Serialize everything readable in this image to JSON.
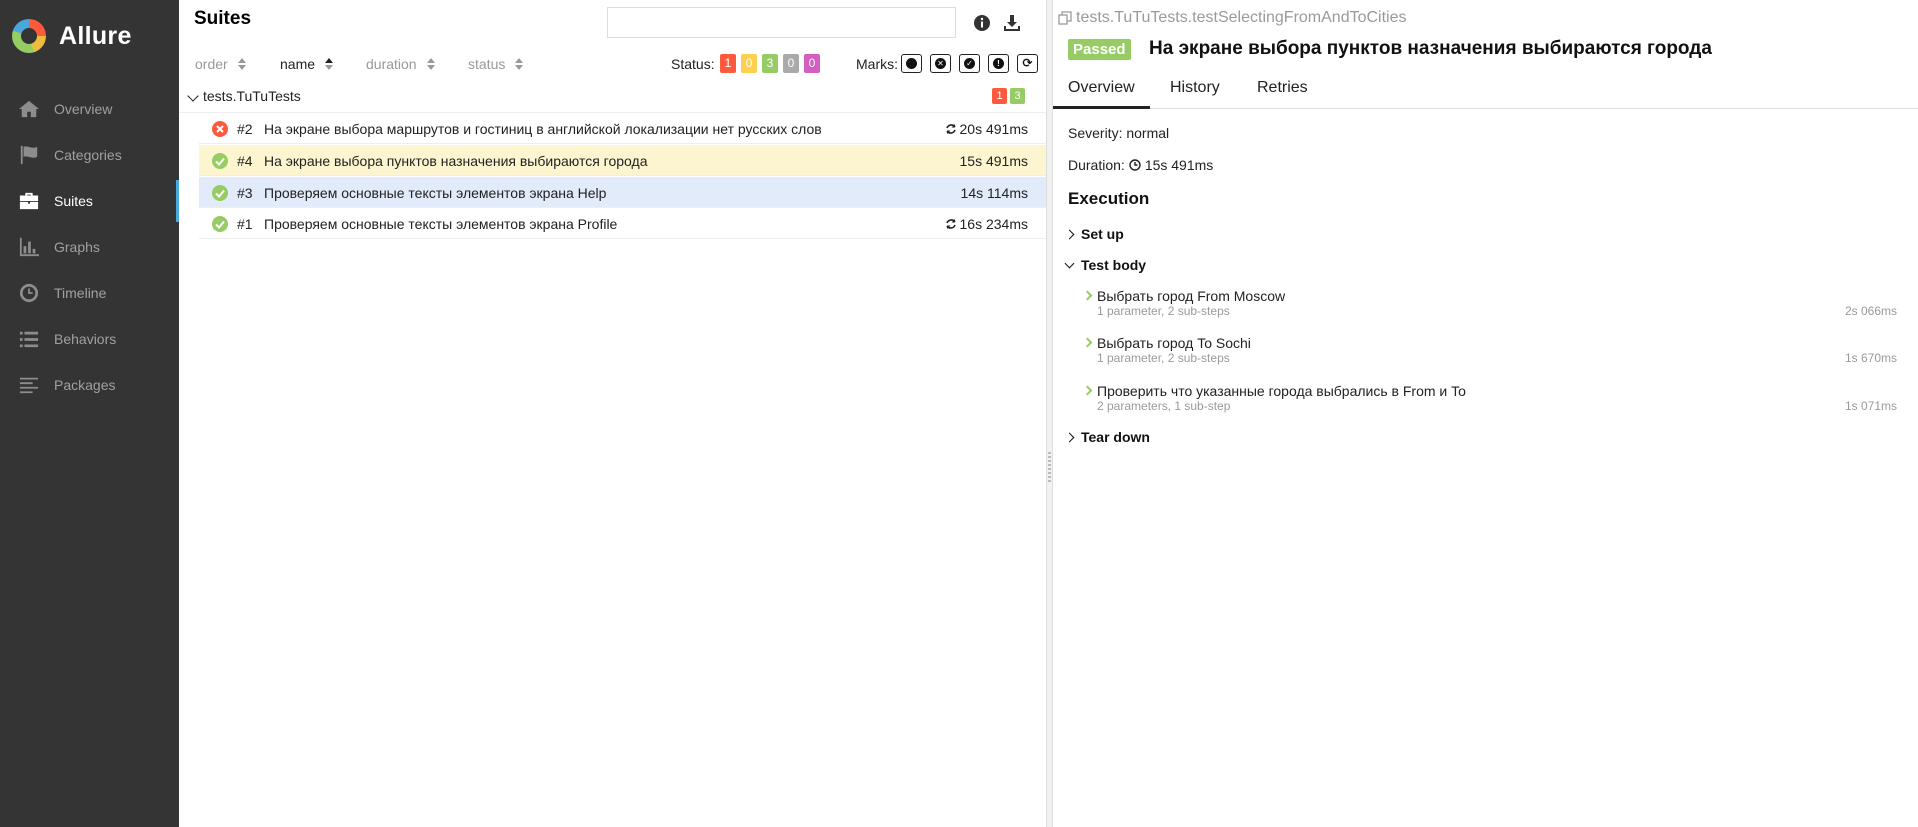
{
  "brand": {
    "name": "Allure"
  },
  "nav": [
    {
      "label": "Overview",
      "icon": "home-icon"
    },
    {
      "label": "Categories",
      "icon": "flag-icon"
    },
    {
      "label": "Suites",
      "icon": "briefcase-icon",
      "active": true
    },
    {
      "label": "Graphs",
      "icon": "bar-chart-icon"
    },
    {
      "label": "Timeline",
      "icon": "clock-icon"
    },
    {
      "label": "Behaviors",
      "icon": "list-icon"
    },
    {
      "label": "Packages",
      "icon": "align-left-icon"
    }
  ],
  "suites": {
    "title": "Suites",
    "search": {
      "value": "",
      "placeholder": ""
    },
    "sort": [
      {
        "label": "order",
        "active": false
      },
      {
        "label": "name",
        "active": true
      },
      {
        "label": "duration",
        "active": false
      },
      {
        "label": "status",
        "active": false
      }
    ],
    "status_label": "Status:",
    "status_counts": [
      {
        "value": "1",
        "color": "#fd5a3e"
      },
      {
        "value": "0",
        "color": "#ffd050"
      },
      {
        "value": "3",
        "color": "#97cc64"
      },
      {
        "value": "0",
        "color": "#aaaaaa"
      },
      {
        "value": "0",
        "color": "#d35ebe"
      }
    ],
    "marks_label": "Marks:",
    "group": {
      "name": "tests.TuTuTests",
      "failed": "1",
      "passed": "3"
    },
    "rows": [
      {
        "num": "#2",
        "title": "На экране выбора маршрутов и гостиниц в английской локализации нет русских слов",
        "duration": "20s 491ms",
        "status": "failed",
        "retried": true
      },
      {
        "num": "#4",
        "title": "На экране выбора пунктов назначения выбираются города",
        "duration": "15s 491ms",
        "status": "passed",
        "retried": false
      },
      {
        "num": "#3",
        "title": "Проверяем основные тексты элементов экрана Help",
        "duration": "14s 114ms",
        "status": "passed",
        "retried": false
      },
      {
        "num": "#1",
        "title": "Проверяем основные тексты элементов экрана Profile",
        "duration": "16s 234ms",
        "status": "passed",
        "retried": true
      }
    ]
  },
  "detail": {
    "full_name": "tests.TuTuTests.testSelectingFromAndToCities",
    "status_badge": "Passed",
    "title": "На экране выбора пунктов назначения выбираются города",
    "tabs": [
      "Overview",
      "History",
      "Retries"
    ],
    "severity_label": "Severity:",
    "severity": "normal",
    "duration_label": "Duration:",
    "duration": "15s 491ms",
    "execution_title": "Execution",
    "setup_label": "Set up",
    "body_label": "Test body",
    "teardown_label": "Tear down",
    "steps": [
      {
        "name": "Выбрать город From Moscow",
        "sub": "1 parameter, 2 sub-steps",
        "duration": "2s 066ms"
      },
      {
        "name": "Выбрать город To Sochi",
        "sub": "1 parameter, 2 sub-steps",
        "duration": "1s 670ms"
      },
      {
        "name": "Проверить что указанные города выбрались в From и To",
        "sub": "2 parameters, 1 sub-step",
        "duration": "1s 071ms"
      }
    ]
  }
}
